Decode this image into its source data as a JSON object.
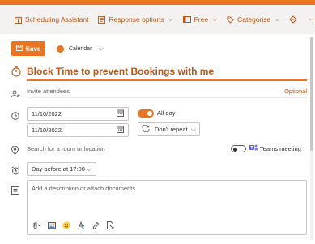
{
  "colors": {
    "accent": "#ea7420",
    "accent_text": "#b4581d",
    "toolbar_bg": "#f3f2f1"
  },
  "toolbar": {
    "scheduling_assistant": "Scheduling Assistant",
    "response_options": "Response options",
    "free": "Free",
    "categorise": "Categorise",
    "more": "···"
  },
  "actions": {
    "save_label": "Save",
    "calendar_label": "Calendar"
  },
  "event": {
    "title": "Block Time to prevent Bookings with me",
    "attendees_placeholder": "Invite attendees",
    "optional_label": "Optional",
    "start_date": "11/10/2022",
    "end_date": "11/10/2022",
    "all_day_label": "All day",
    "all_day_on": true,
    "repeat": "Don't repeat",
    "location_placeholder": "Search for a room or location",
    "teams_label": "Teams meeting",
    "teams_on": false,
    "reminder": "Day before at 17:00",
    "description_placeholder": "Add a description or attach documents"
  },
  "icons": {
    "toolbar": [
      "scheduling-icon",
      "response-options-icon",
      "free-busy-icon",
      "categorise-icon",
      "immersive-reader-icon",
      "more-icon"
    ],
    "rows": [
      "clock-icon",
      "people-add-icon",
      "time-icon",
      "location-icon",
      "alarm-icon",
      "notes-icon"
    ],
    "description_tools": [
      "attach-icon",
      "image-icon",
      "emoji-icon",
      "format-icon",
      "highlight-icon",
      "file-icon"
    ]
  }
}
